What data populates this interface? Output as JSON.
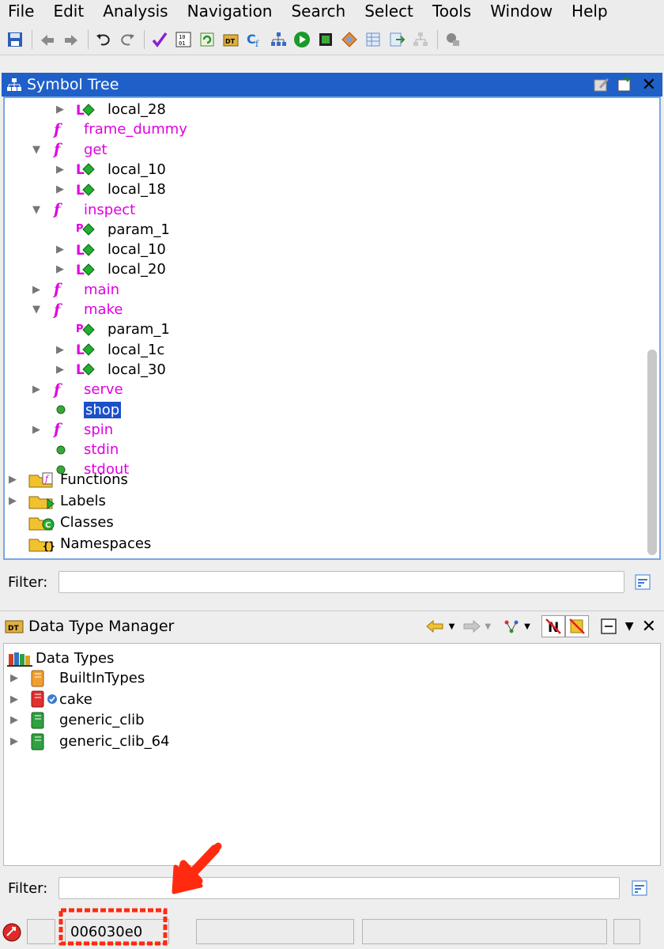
{
  "menu": [
    "File",
    "Edit",
    "Analysis",
    "Navigation",
    "Search",
    "Select",
    "Tools",
    "Window",
    "Help"
  ],
  "toolbar_icons": [
    "save-icon",
    "back-icon",
    "forward-icon",
    "undo-icon",
    "redo-icon",
    "checkmark-icon",
    "bytes-icon",
    "refresh-icon",
    "datatype-icon",
    "cf-icon",
    "tree-icon",
    "run-icon",
    "chip-icon",
    "diamond-icon",
    "table-icon",
    "export-icon",
    "graph-icon",
    "snapshot-icon"
  ],
  "symbol_tree": {
    "title": "Symbol Tree",
    "filter_label": "Filter:",
    "items": [
      {
        "label": "local_28",
        "type": "local",
        "indent": 2,
        "expander": "collapsed"
      },
      {
        "label": "frame_dummy",
        "type": "function",
        "indent": 1,
        "expander": "none"
      },
      {
        "label": "get",
        "type": "function",
        "indent": 1,
        "expander": "expanded"
      },
      {
        "label": "local_10",
        "type": "local",
        "indent": 2,
        "expander": "collapsed"
      },
      {
        "label": "local_18",
        "type": "local",
        "indent": 2,
        "expander": "collapsed"
      },
      {
        "label": "inspect",
        "type": "function",
        "indent": 1,
        "expander": "expanded"
      },
      {
        "label": "param_1",
        "type": "param",
        "indent": 2,
        "expander": "none"
      },
      {
        "label": "local_10",
        "type": "local",
        "indent": 2,
        "expander": "collapsed"
      },
      {
        "label": "local_20",
        "type": "local",
        "indent": 2,
        "expander": "collapsed"
      },
      {
        "label": "main",
        "type": "function",
        "indent": 1,
        "expander": "collapsed"
      },
      {
        "label": "make",
        "type": "function",
        "indent": 1,
        "expander": "expanded"
      },
      {
        "label": "param_1",
        "type": "param",
        "indent": 2,
        "expander": "none"
      },
      {
        "label": "local_1c",
        "type": "local",
        "indent": 2,
        "expander": "collapsed"
      },
      {
        "label": "local_30",
        "type": "local",
        "indent": 2,
        "expander": "collapsed"
      },
      {
        "label": "serve",
        "type": "function",
        "indent": 1,
        "expander": "collapsed"
      },
      {
        "label": "shop",
        "type": "global",
        "indent": 1,
        "expander": "none",
        "selected": true
      },
      {
        "label": "spin",
        "type": "function",
        "indent": 1,
        "expander": "collapsed"
      },
      {
        "label": "stdin",
        "type": "global",
        "indent": 1,
        "expander": "none"
      },
      {
        "label": "stdout",
        "type": "global",
        "indent": 1,
        "expander": "none"
      }
    ],
    "folders": [
      {
        "label": "Functions",
        "icon": "functions-folder-icon",
        "expander": "collapsed"
      },
      {
        "label": "Labels",
        "icon": "labels-folder-icon",
        "expander": "collapsed"
      },
      {
        "label": "Classes",
        "icon": "classes-folder-icon",
        "expander": "none"
      },
      {
        "label": "Namespaces",
        "icon": "namespaces-folder-icon",
        "expander": "none"
      }
    ]
  },
  "data_type_manager": {
    "title": "Data Type Manager",
    "root_label": "Data Types",
    "archives": [
      {
        "label": "BuiltInTypes",
        "color": "orange"
      },
      {
        "label": "cake",
        "color": "red",
        "checked": true
      },
      {
        "label": "generic_clib",
        "color": "green"
      },
      {
        "label": "generic_clib_64",
        "color": "green"
      }
    ],
    "filter_label": "Filter:"
  },
  "status_bar": {
    "address": "006030e0"
  },
  "colors": {
    "function_text": "#e000e0",
    "selection_bg": "#1c50c8",
    "focus_border": "#7aa7e0",
    "annotation_red": "#ff2a10"
  }
}
